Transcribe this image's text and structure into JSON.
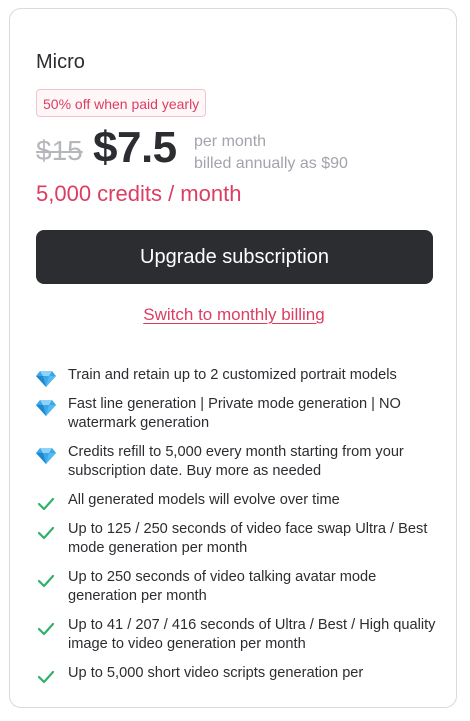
{
  "plan": {
    "name": "Micro",
    "discount_badge": "50% off when paid yearly",
    "old_price": "$15",
    "new_price": "$7.5",
    "period": "per month",
    "billed_note": "billed annually as $90",
    "credits": "5,000 credits / month",
    "upgrade_label": "Upgrade subscription",
    "switch_billing_label": "Switch to monthly billing"
  },
  "colors": {
    "accent": "#dc3d62",
    "button_bg": "#2b2d31",
    "muted": "#a2a4ab",
    "check": "#2fb36b",
    "diamond": "#3aa8e8"
  },
  "features": [
    {
      "icon": "diamond-icon",
      "text": "Train and retain up to 2 customized portrait models"
    },
    {
      "icon": "diamond-icon",
      "text": "Fast line generation | Private mode generation | NO watermark generation"
    },
    {
      "icon": "diamond-icon",
      "text": "Credits refill to 5,000 every month starting from your subscription date. Buy more as needed"
    },
    {
      "icon": "check-icon",
      "text": "All generated models will evolve over time"
    },
    {
      "icon": "check-icon",
      "text": "Up to 125 / 250 seconds of video face swap Ultra / Best mode generation per month"
    },
    {
      "icon": "check-icon",
      "text": "Up to 250 seconds of video talking avatar mode generation per month"
    },
    {
      "icon": "check-icon",
      "text": "Up to 41 / 207 / 416 seconds of Ultra / Best / High quality image to video generation per month"
    },
    {
      "icon": "check-icon",
      "text": "Up to 5,000 short video scripts generation per"
    }
  ]
}
